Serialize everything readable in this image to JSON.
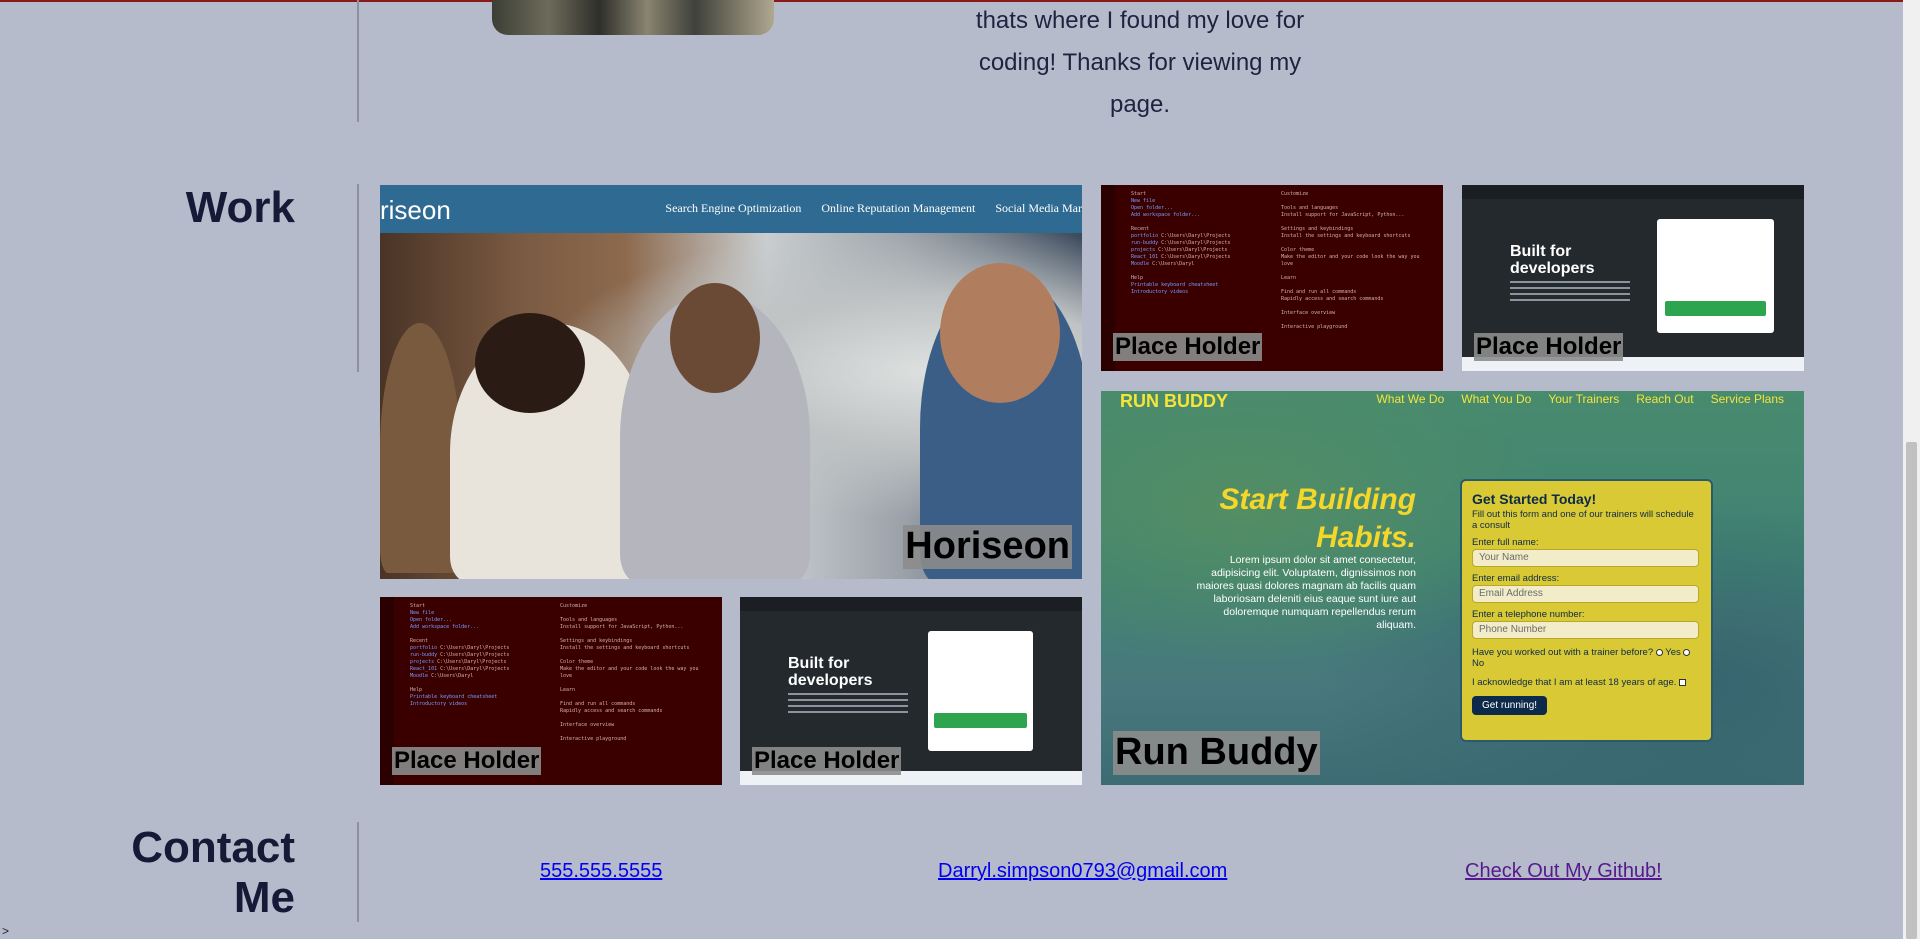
{
  "about": {
    "text_line1": "thats where I found my love for",
    "text_line2": "coding! Thanks for viewing my",
    "text_line3": "page."
  },
  "work": {
    "title": "Work",
    "projects": [
      {
        "label": "Horiseon",
        "logo": "riseon",
        "nav": [
          "Search Engine Optimization",
          "Online Reputation Management",
          "Social Media Mar"
        ]
      },
      {
        "label": "Place Holder"
      },
      {
        "label": "Place Holder",
        "heading": "Built for developers"
      },
      {
        "label": "Place Holder"
      },
      {
        "label": "Place Holder",
        "heading": "Built for developers"
      },
      {
        "label": "Run Buddy",
        "logo": "RUN BUDDY",
        "nav": [
          "What We Do",
          "What You Do",
          "Your Trainers",
          "Reach Out",
          "Service Plans"
        ],
        "headline": "Start Building Habits.",
        "lorem": "Lorem ipsum dolor sit amet consectetur, adipisicing elit. Voluptatem, dignissimos non maiores quasi dolores magnam ab facilis quam laboriosam deleniti eius eaque sunt iure aut doloremque numquam repellendus rerum aliquam.",
        "form": {
          "title": "Get Started Today!",
          "subtitle": "Fill out this form and one of our trainers will schedule a consult",
          "name_label": "Enter full name:",
          "name_placeholder": "Your Name",
          "email_label": "Enter email address:",
          "email_placeholder": "Email Address",
          "phone_label": "Enter a telephone number:",
          "phone_placeholder": "Phone Number",
          "trainer_question": "Have you worked out with a trainer before?",
          "yes": "Yes",
          "no": "No",
          "age_ack": "I acknowledge that I am at least 18 years of age.",
          "button": "Get running!"
        }
      }
    ]
  },
  "contact": {
    "title_line1": "Contact",
    "title_line2": "Me",
    "phone": "555.555.5555",
    "email": "Darryl.simpson0793@gmail.com",
    "github": "Check Out My Github!"
  },
  "corner_mark": ">"
}
